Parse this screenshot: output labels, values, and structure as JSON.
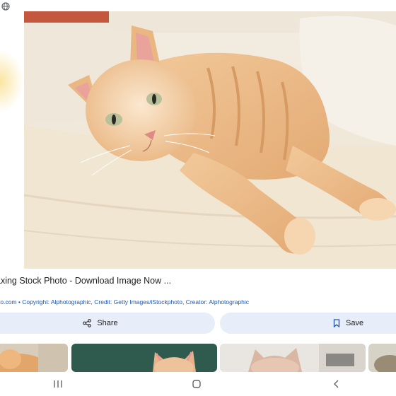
{
  "header": {
    "icon": "globe-icon"
  },
  "result": {
    "title": "axing Stock Photo - Download Image Now ...",
    "meta": "to.com • Copyright: Alphotographic, Credit: Getty Images/iStockphoto, Creator: Alphotographic",
    "image_subject": "cat-photo"
  },
  "actions": {
    "share_label": "Share",
    "save_label": "Save"
  },
  "colors": {
    "button_bg": "#e8eef9",
    "link": "#1a57b5"
  },
  "related": {
    "thumbnails": [
      "cat-thumbnail-1",
      "cat-thumbnail-2",
      "cat-thumbnail-3",
      "cat-thumbnail-4"
    ]
  },
  "system_nav": {
    "icons": [
      "recent-apps-icon",
      "home-icon",
      "back-icon"
    ]
  }
}
